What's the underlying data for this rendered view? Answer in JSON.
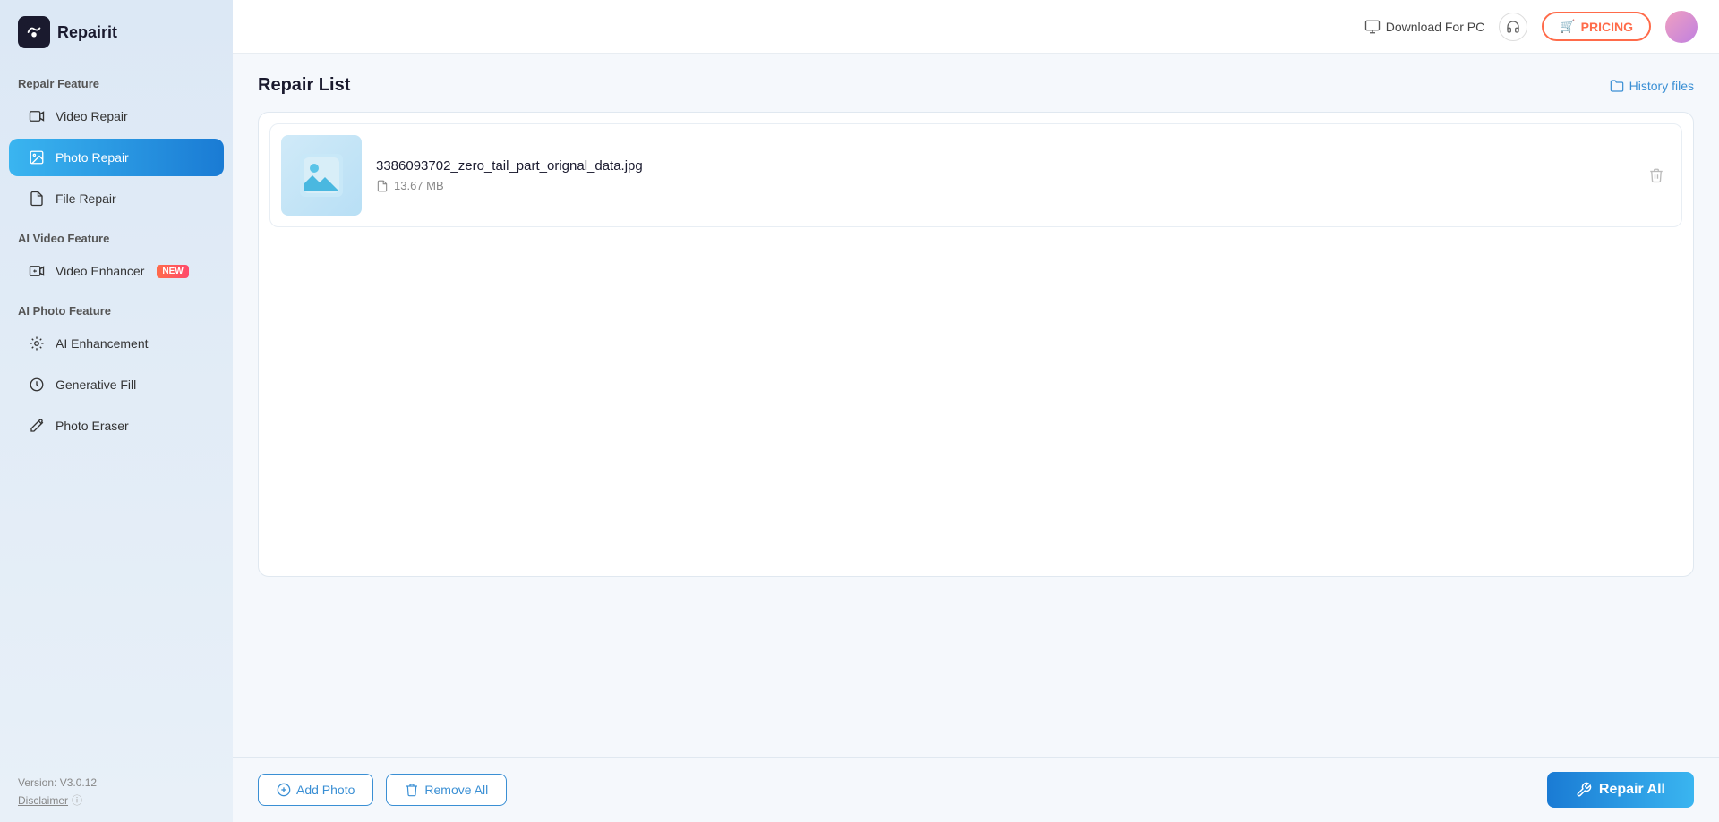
{
  "app": {
    "logo_icon": "🔧",
    "logo_text": "Repairit"
  },
  "sidebar": {
    "repair_feature_section": "Repair Feature",
    "ai_video_section": "AI Video Feature",
    "ai_photo_section": "AI Photo Feature",
    "items": [
      {
        "id": "video-repair",
        "label": "Video Repair",
        "active": false,
        "icon": "▶"
      },
      {
        "id": "photo-repair",
        "label": "Photo Repair",
        "active": true,
        "icon": "🖼"
      },
      {
        "id": "file-repair",
        "label": "File Repair",
        "active": false,
        "icon": "📄"
      },
      {
        "id": "video-enhancer",
        "label": "Video Enhancer",
        "active": false,
        "icon": "🎬",
        "badge": "NEW"
      },
      {
        "id": "ai-enhancement",
        "label": "AI Enhancement",
        "active": false,
        "icon": "✨"
      },
      {
        "id": "generative-fill",
        "label": "Generative Fill",
        "active": false,
        "icon": "🎨"
      },
      {
        "id": "photo-eraser",
        "label": "Photo Eraser",
        "active": false,
        "icon": "◇"
      }
    ],
    "version": "Version: V3.0.12",
    "disclaimer": "Disclaimer"
  },
  "topbar": {
    "download_label": "Download For PC",
    "pricing_label": "PRICING",
    "pricing_icon": "🛒"
  },
  "main": {
    "title": "Repair List",
    "history_files_label": "History files"
  },
  "file_list": {
    "files": [
      {
        "name": "3386093702_zero_tail_part_orignal_data.jpg",
        "size": "13.67 MB"
      }
    ]
  },
  "bottom_bar": {
    "add_photo_label": "Add Photo",
    "remove_all_label": "Remove All",
    "repair_all_label": "Repair All"
  }
}
